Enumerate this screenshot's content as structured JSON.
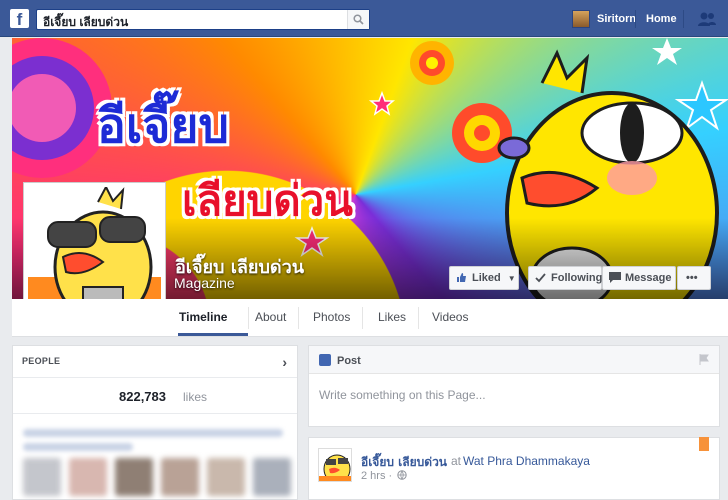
{
  "topbar": {
    "search_value": "อีเจี๊ยบ เลียบด่วน",
    "user_name": "Siritorn",
    "home_label": "Home"
  },
  "page": {
    "name": "อีเจี๊ยบ เลียบด่วน",
    "category": "Magazine",
    "cover_title_line1": "อีเจี๊ยบ",
    "cover_title_line2": "เลียบด่วน"
  },
  "actions": {
    "liked_label": "Liked",
    "following_label": "Following",
    "message_label": "Message",
    "more_label": "•••"
  },
  "tabs": [
    {
      "label": "Timeline"
    },
    {
      "label": "About"
    },
    {
      "label": "Photos"
    },
    {
      "label": "Likes"
    },
    {
      "label": "Videos"
    }
  ],
  "people": {
    "heading": "PEOPLE",
    "likes_count": "822,783",
    "likes_label": "likes"
  },
  "composer": {
    "tab_label": "Post",
    "placeholder": "Write something on this Page..."
  },
  "feed_post": {
    "author": "อีเจี๊ยบ เลียบด่วน",
    "at_label": "at",
    "place": "Wat Phra Dhammakaya",
    "time": "2 hrs ·"
  },
  "colors": {
    "brand_blue": "#3b5998",
    "link_blue": "#365899"
  },
  "icons": {
    "logo": "facebook-logo-icon",
    "search": "search-icon",
    "friends": "friends-icon",
    "like": "thumbs-up-icon",
    "check": "check-icon",
    "message": "message-icon",
    "post": "pencil-icon",
    "flag": "flag-icon",
    "globe": "globe-icon",
    "bookmark": "bookmark-icon"
  }
}
